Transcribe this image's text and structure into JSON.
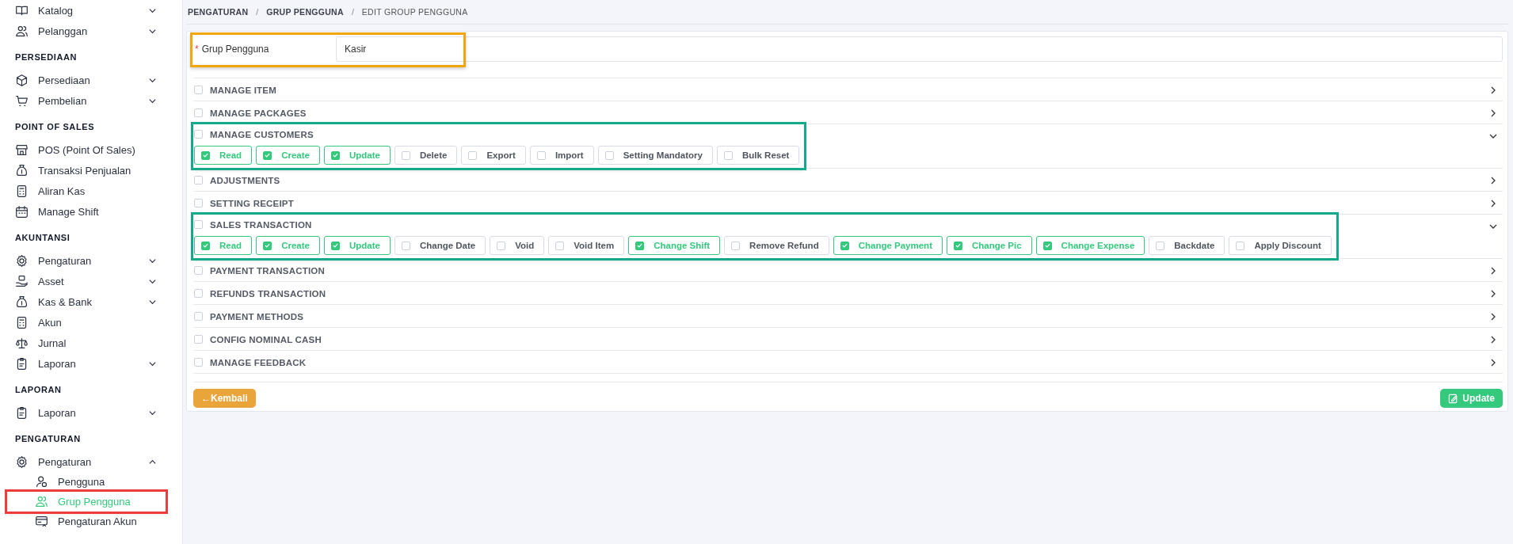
{
  "sidebar": {
    "groups": [
      {
        "items": [
          {
            "label": "Katalog",
            "kind": "group",
            "expanded": false,
            "selected": false,
            "highlighted": false
          },
          {
            "label": "Pelanggan",
            "kind": "group",
            "expanded": false,
            "selected": false,
            "highlighted": false
          }
        ]
      },
      {
        "title": "PERSEDIAAN",
        "items": [
          {
            "label": "Persediaan",
            "kind": "group",
            "expanded": false,
            "selected": false,
            "highlighted": false
          },
          {
            "label": "Pembelian",
            "kind": "group",
            "expanded": false,
            "selected": false,
            "highlighted": false
          }
        ]
      },
      {
        "title": "POINT OF SALES",
        "items": [
          {
            "label": "POS (Point Of Sales)",
            "kind": "link",
            "selected": false,
            "highlighted": false
          },
          {
            "label": "Transaksi Penjualan",
            "kind": "link",
            "selected": false,
            "highlighted": false
          },
          {
            "label": "Aliran Kas",
            "kind": "link",
            "selected": false,
            "highlighted": false
          },
          {
            "label": "Manage Shift",
            "kind": "link",
            "selected": false,
            "highlighted": false
          }
        ]
      },
      {
        "title": "AKUNTANSI",
        "items": [
          {
            "label": "Pengaturan",
            "kind": "group",
            "expanded": false,
            "selected": false,
            "highlighted": false
          },
          {
            "label": "Asset",
            "kind": "group",
            "expanded": false,
            "selected": false,
            "highlighted": false
          },
          {
            "label": "Kas & Bank",
            "kind": "group",
            "expanded": false,
            "selected": false,
            "highlighted": false
          },
          {
            "label": "Akun",
            "kind": "link",
            "selected": false,
            "highlighted": false
          },
          {
            "label": "Jurnal",
            "kind": "link",
            "selected": false,
            "highlighted": false
          },
          {
            "label": "Laporan",
            "kind": "group",
            "expanded": false,
            "selected": false,
            "highlighted": false
          }
        ]
      },
      {
        "title": "LAPORAN",
        "items": [
          {
            "label": "Laporan",
            "kind": "group",
            "expanded": false,
            "selected": false,
            "highlighted": false
          }
        ]
      },
      {
        "title": "PENGATURAN",
        "items": [
          {
            "label": "Pengaturan",
            "kind": "group",
            "expanded": true,
            "selected": false,
            "highlighted": false,
            "children": [
              {
                "label": "Pengguna",
                "selected": false,
                "highlighted": false
              },
              {
                "label": "Grup Pengguna",
                "selected": true,
                "highlighted": true
              },
              {
                "label": "Pengaturan Akun",
                "selected": false,
                "highlighted": false
              }
            ]
          }
        ]
      }
    ]
  },
  "breadcrumb": {
    "separator": "/",
    "items": [
      "PENGATURAN",
      "GRUP PENGGUNA",
      "EDIT GROUP PENGGUNA"
    ]
  },
  "field": {
    "label": "Grup Pengguna",
    "required_mark": "*",
    "value": "Kasir",
    "highlighted": true
  },
  "sections": [
    {
      "title": "MANAGE ITEM",
      "checked": false,
      "expanded": false,
      "highlighted": false
    },
    {
      "title": "MANAGE PACKAGES",
      "checked": false,
      "expanded": false,
      "highlighted": false
    },
    {
      "title": "MANAGE CUSTOMERS",
      "checked": false,
      "expanded": true,
      "highlighted": true,
      "permissions": [
        {
          "label": "Read",
          "checked": true
        },
        {
          "label": "Create",
          "checked": true
        },
        {
          "label": "Update",
          "checked": true
        },
        {
          "label": "Delete",
          "checked": false
        },
        {
          "label": "Export",
          "checked": false
        },
        {
          "label": "Import",
          "checked": false
        },
        {
          "label": "Setting Mandatory",
          "checked": false
        },
        {
          "label": "Bulk Reset",
          "checked": false
        }
      ]
    },
    {
      "title": "ADJUSTMENTS",
      "checked": false,
      "expanded": false,
      "highlighted": false
    },
    {
      "title": "SETTING RECEIPT",
      "checked": false,
      "expanded": false,
      "highlighted": false
    },
    {
      "title": "SALES TRANSACTION",
      "checked": false,
      "expanded": true,
      "highlighted": true,
      "permissions": [
        {
          "label": "Read",
          "checked": true
        },
        {
          "label": "Create",
          "checked": true
        },
        {
          "label": "Update",
          "checked": true
        },
        {
          "label": "Change Date",
          "checked": false
        },
        {
          "label": "Void",
          "checked": false
        },
        {
          "label": "Void Item",
          "checked": false
        },
        {
          "label": "Change Shift",
          "checked": true
        },
        {
          "label": "Remove Refund",
          "checked": false
        },
        {
          "label": "Change Payment",
          "checked": true
        },
        {
          "label": "Change Pic",
          "checked": true
        },
        {
          "label": "Change Expense",
          "checked": true
        },
        {
          "label": "Backdate",
          "checked": false
        },
        {
          "label": "Apply Discount",
          "checked": false
        }
      ]
    },
    {
      "title": "PAYMENT TRANSACTION",
      "checked": false,
      "expanded": false,
      "highlighted": false
    },
    {
      "title": "REFUNDS TRANSACTION",
      "checked": false,
      "expanded": false,
      "highlighted": false
    },
    {
      "title": "PAYMENT METHODS",
      "checked": false,
      "expanded": false,
      "highlighted": false
    },
    {
      "title": "CONFIG NOMINAL CASH",
      "checked": false,
      "expanded": false,
      "highlighted": false
    },
    {
      "title": "MANAGE FEEDBACK",
      "checked": false,
      "expanded": false,
      "highlighted": false
    }
  ],
  "back_button": "←Kembali",
  "update_button": "Update"
}
